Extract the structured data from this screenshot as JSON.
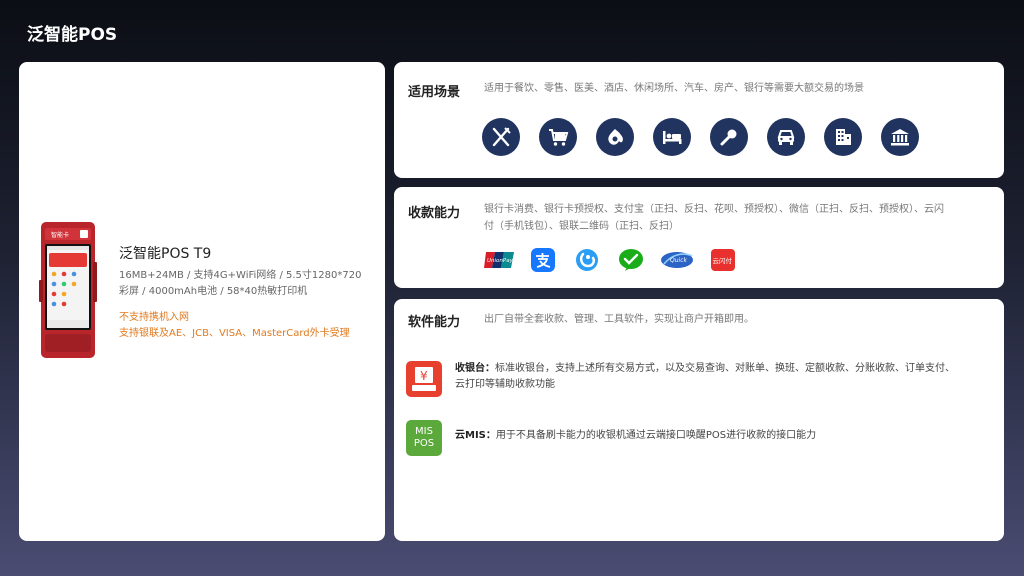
{
  "page": {
    "title": "泛智能POS"
  },
  "product": {
    "name": "泛智能POS T9",
    "spec_line1": "16MB+24MB / 支持4G+WiFi网络 / 5.5寸1280*720",
    "spec_line2": "彩屏 / 4000mAh电池 / 58*40热敏打印机",
    "note_line1": "不支持携机入网",
    "note_line2": "支持银联及AE、JCB、VISA、MasterCard外卡受理",
    "device_brand": "智能卡",
    "accent_color": "#c8262b"
  },
  "scenes": {
    "title": "适用场景",
    "desc": "适用于餐饮、零售、医美、酒店、休闲场所、汽车、房产、银行等需要大额交易的场景",
    "icons": [
      "fork-knife-icon",
      "shopping-cart-icon",
      "beauty-icon",
      "bed-icon",
      "microphone-icon",
      "car-icon",
      "building-icon",
      "bank-icon"
    ],
    "icon_color": "#21335f"
  },
  "payment": {
    "title": "收款能力",
    "desc_line1": "银行卡消费、银行卡预授权、支付宝（正扫、反扫、花呗、预授权）、微信（正扫、反扫、预授权）、云闪",
    "desc_line2": "付（手机钱包）、银联二维码（正扫、反扫）",
    "logos": [
      "unionpay-logo",
      "alipay-logo",
      "huabei-logo",
      "wechat-pay-logo",
      "quickpass-logo",
      "yunshanfu-logo"
    ],
    "logo_texts": {
      "unionpay": "UnionPay",
      "quickpass": "Quick",
      "yunshanfu": "云闪付"
    }
  },
  "software": {
    "title": "软件能力",
    "desc": "出厂自带全套收款、管理、工具软件，实现让商户开箱即用。",
    "items": [
      {
        "name": "收银台：",
        "desc_line1": "标准收银台，支持上述所有交易方式，以及交易查询、对账单、换班、定额收款、分账收款、订单支付、",
        "desc_line2": "云打印等辅助收款功能"
      },
      {
        "name": "云MIS：",
        "desc_line1": "用于不具备刷卡能力的收银机通过云端接口唤醒POS进行收款的接口能力",
        "icon_text_line1": "MIS",
        "icon_text_line2": "POS"
      }
    ],
    "cashier_icon_symbol": "¥"
  }
}
